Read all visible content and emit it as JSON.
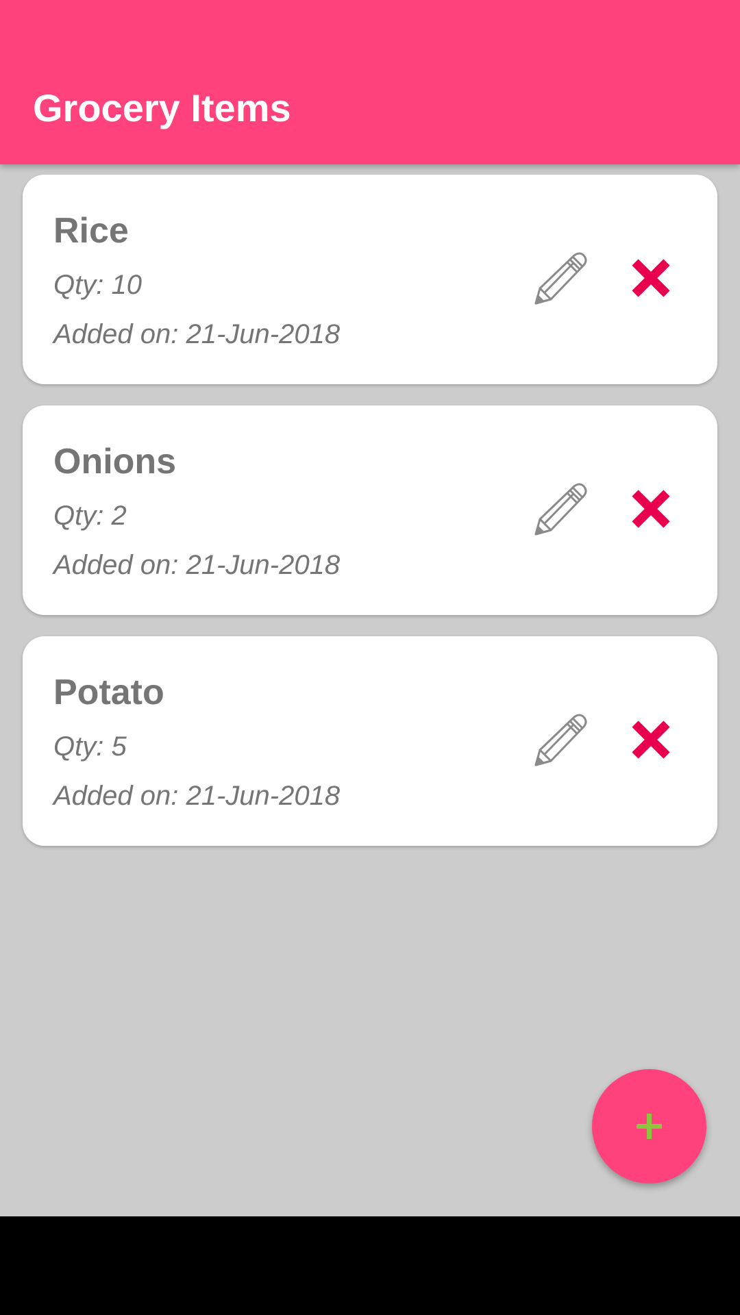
{
  "app_bar": {
    "title": "Grocery Items",
    "color": "#ff417c"
  },
  "items": [
    {
      "name": "Rice",
      "qty": "Qty: 10",
      "added": "Added on: 21-Jun-2018",
      "edit_icon": "pencil-icon",
      "delete_icon": "close-icon"
    },
    {
      "name": "Onions",
      "qty": "Qty: 2",
      "added": "Added on: 21-Jun-2018",
      "edit_icon": "pencil-icon",
      "delete_icon": "close-icon"
    },
    {
      "name": "Potato",
      "qty": "Qty: 5",
      "added": "Added on: 21-Jun-2018",
      "edit_icon": "pencil-icon",
      "delete_icon": "close-icon"
    }
  ],
  "fab": {
    "icon": "plus-icon",
    "icon_color": "#8cc63f",
    "color": "#ff417c"
  },
  "colors": {
    "background": "#cccccc",
    "card": "#ffffff",
    "text": "#757575",
    "delete": "#e8004f"
  }
}
